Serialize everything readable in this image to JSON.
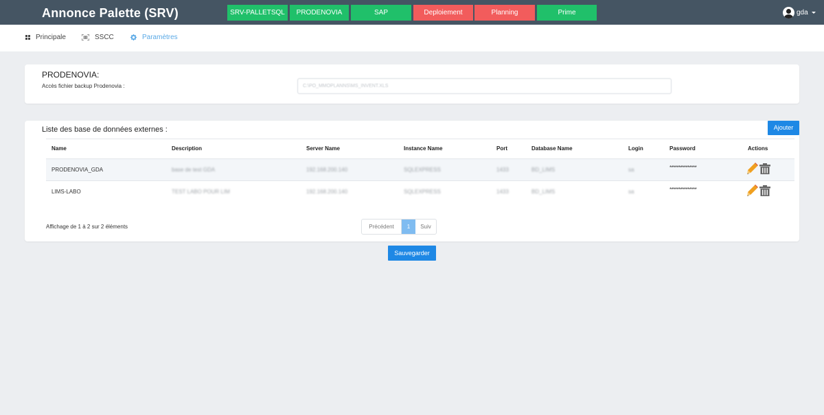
{
  "header": {
    "title": "Annonce Palette (SRV)",
    "env_buttons": [
      {
        "label": "SRV-PALLETSQL",
        "color": "#20c06a"
      },
      {
        "label": "PRODENOVIA",
        "color": "#20c06a"
      },
      {
        "label": "SAP",
        "color": "#20c06a"
      },
      {
        "label": "Deploiement",
        "color": "#f25c5c"
      },
      {
        "label": "Planning",
        "color": "#f25c5c"
      },
      {
        "label": "Prime",
        "color": "#20c06a"
      }
    ],
    "user": "gda"
  },
  "nav": {
    "items": [
      {
        "label": "Principale",
        "icon": "dashboard-icon"
      },
      {
        "label": "SSCC",
        "icon": "barcode-scan-icon"
      },
      {
        "label": "Paramètres",
        "icon": "gear-icon",
        "active": true
      }
    ]
  },
  "prodenovia": {
    "title": "PRODENOVIA:",
    "label": "Accès fichier backup Prodenovia :",
    "value": "C:\\PO_MMOPLANNS\\MS_INVENT.XLS"
  },
  "external_db": {
    "title": "Liste des base de données externes :",
    "add_label": "Ajouter",
    "columns": [
      "Name",
      "Description",
      "Server Name",
      "Instance Name",
      "Port",
      "Database Name",
      "Login",
      "Password",
      "Actions"
    ],
    "rows": [
      {
        "name": "PRODENOVIA_GDA",
        "description": "base de test GDA",
        "server": "192.168.200.140",
        "instance": "SQLEXPRESS",
        "port": "1433",
        "database": "BD_LIMS",
        "login": "sa",
        "password": "***************"
      },
      {
        "name": "LIMS-LABO",
        "description": "TEST LABO POUR LIM",
        "server": "192.168.200.140",
        "instance": "SQLEXPRESS",
        "port": "1433",
        "database": "BD_LIMS",
        "login": "sa",
        "password": "***************"
      }
    ],
    "info": "Affichage de 1 à 2 sur 2 éléments",
    "pagination": {
      "prev": "Précédent",
      "current": "1",
      "next": "Suiv"
    }
  },
  "save_label": "Sauvegarder",
  "colors": {
    "topbar": "#455563",
    "accent": "#1e88e5",
    "green": "#20c06a",
    "red": "#f25c5c",
    "pencil": "#f0a020",
    "trash": "#666666"
  }
}
